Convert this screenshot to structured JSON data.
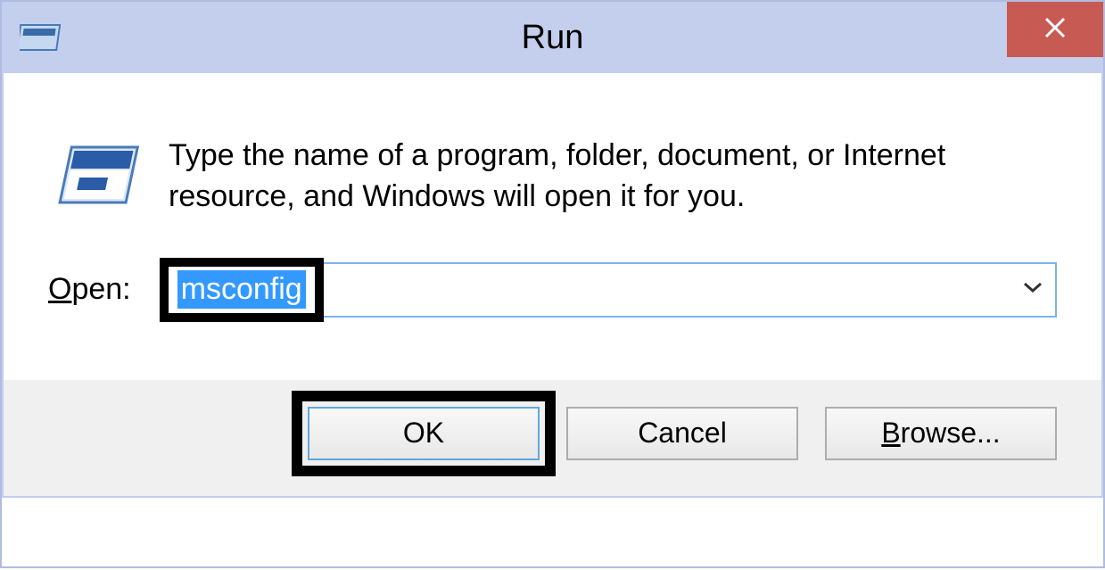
{
  "titlebar": {
    "title": "Run"
  },
  "content": {
    "description": "Type the name of a program, folder, document, or Internet resource, and Windows will open it for you.",
    "open_label_prefix": "O",
    "open_label_rest": "pen:",
    "input_value": "msconfig"
  },
  "buttons": {
    "ok": "OK",
    "cancel": "Cancel",
    "browse_prefix": "B",
    "browse_rest": "rowse..."
  }
}
